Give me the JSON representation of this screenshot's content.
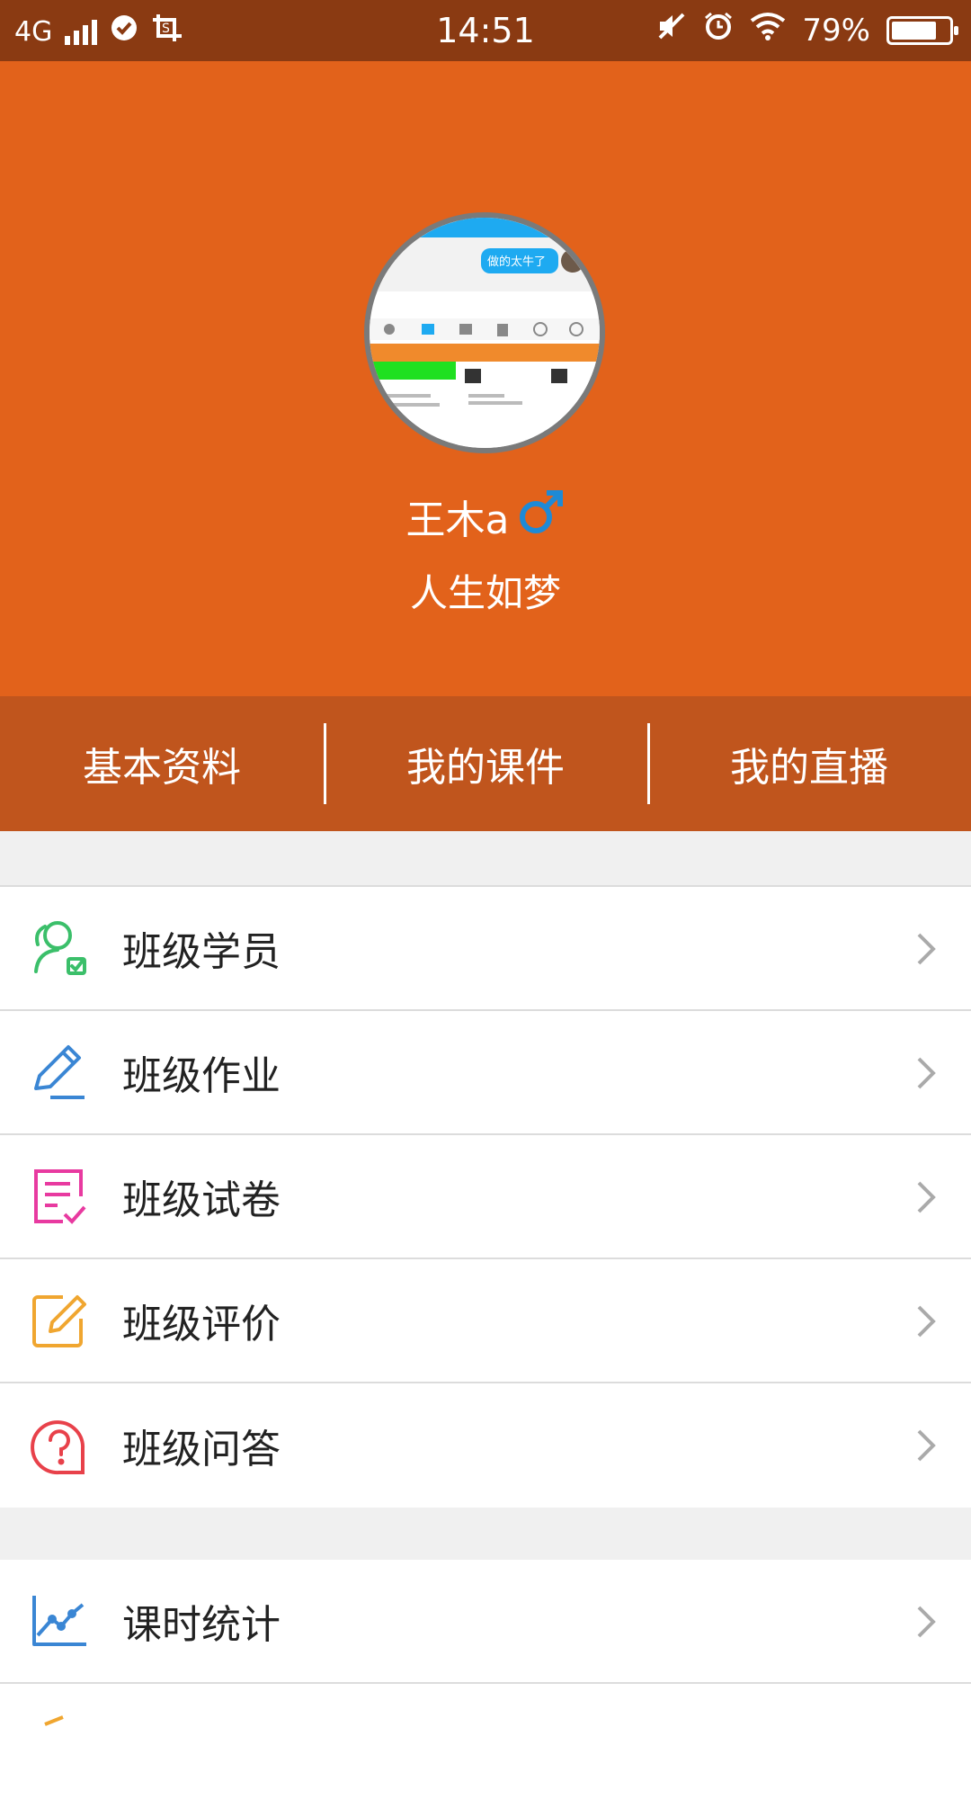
{
  "status_bar": {
    "network": "4G",
    "time": "14:51",
    "battery_percent": "79%",
    "battery_level": 0.79
  },
  "profile": {
    "name": "王木a",
    "gender_symbol": "♂",
    "motto": "人生如梦",
    "avatar_texts": {
      "chat_bubble": "做的太牛了"
    }
  },
  "tabs": [
    {
      "label": "基本资料"
    },
    {
      "label": "我的课件"
    },
    {
      "label": "我的直播"
    }
  ],
  "menu_group_1": [
    {
      "label": "班级学员",
      "icon": "students-icon",
      "color": "#3bbf6a"
    },
    {
      "label": "班级作业",
      "icon": "pencil-icon",
      "color": "#3a86d4"
    },
    {
      "label": "班级试卷",
      "icon": "test-paper-icon",
      "color": "#e83aa0"
    },
    {
      "label": "班级评价",
      "icon": "edit-note-icon",
      "color": "#f0a630"
    },
    {
      "label": "班级问答",
      "icon": "question-icon",
      "color": "#e8414a"
    }
  ],
  "menu_group_2": [
    {
      "label": "课时统计",
      "icon": "chart-line-icon",
      "color": "#3a86d4"
    }
  ],
  "colors": {
    "status_bar": "#8a3a12",
    "header": "#e2621b",
    "tabs_bar": "#c0551d",
    "male_symbol": "#1e8ad6"
  }
}
